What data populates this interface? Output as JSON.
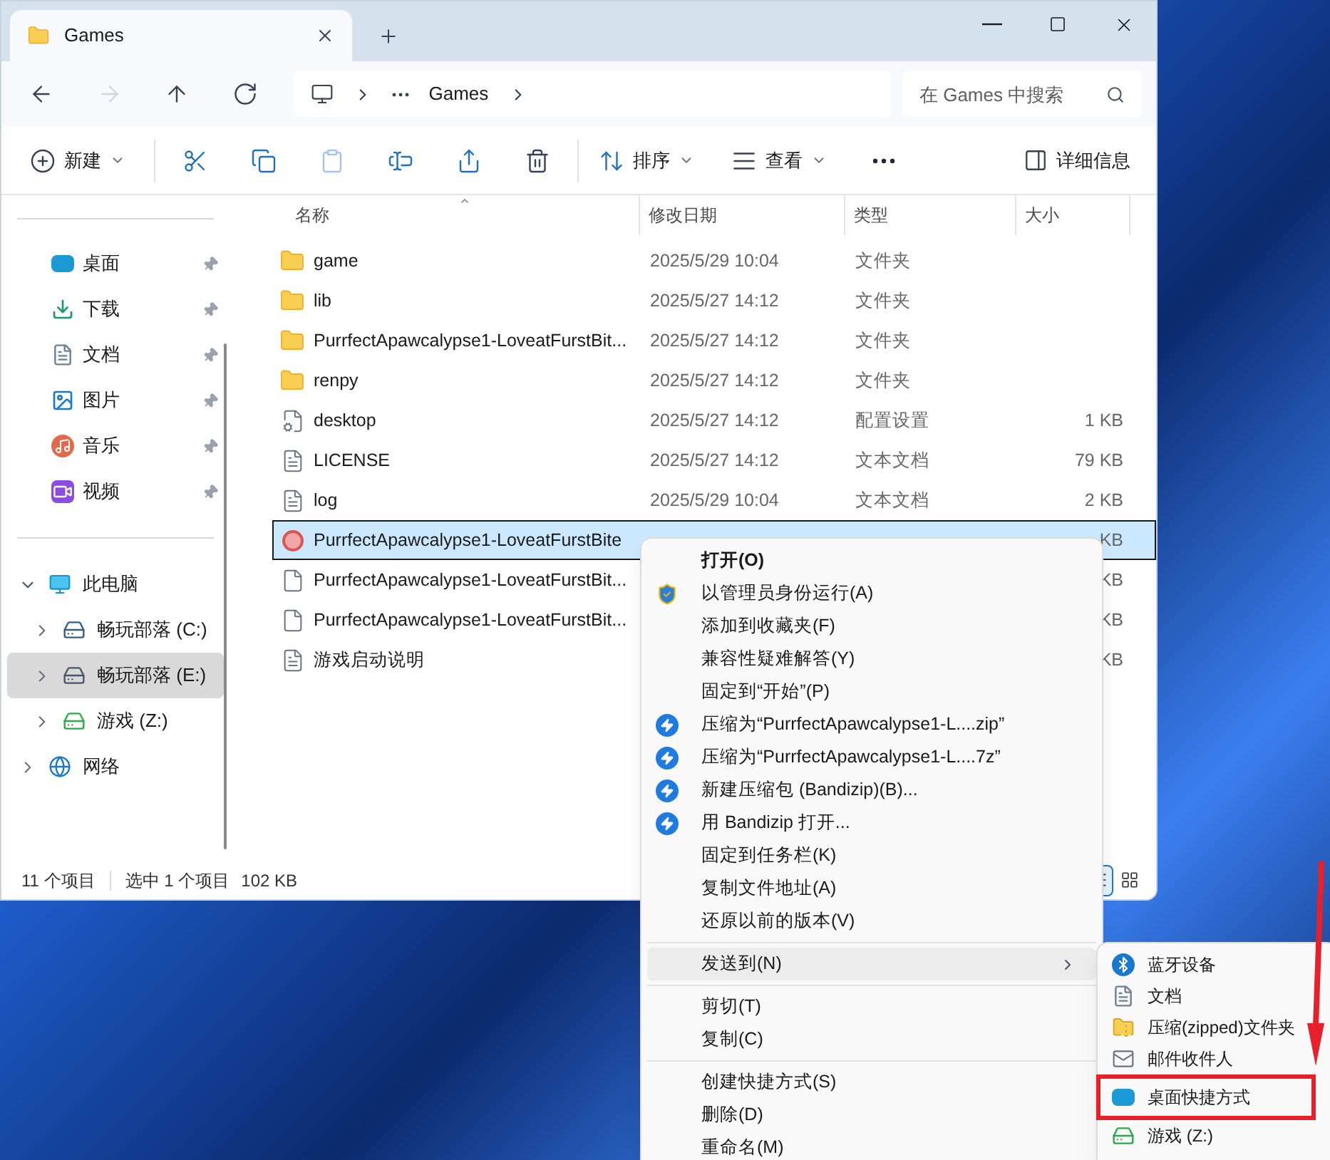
{
  "window": {
    "tab_title": "Games"
  },
  "nav_buttons": [
    {
      "kind": "back",
      "disabled": false
    },
    {
      "kind": "forward",
      "disabled": true
    },
    {
      "kind": "up",
      "disabled": false
    },
    {
      "kind": "refresh",
      "disabled": false
    }
  ],
  "address": {
    "segments": [
      "Games"
    ]
  },
  "search": {
    "placeholder": "在 Games 中搜索"
  },
  "toolbar": [
    {
      "kind": "new",
      "label": "新建",
      "dropdown": true,
      "disabled": false
    },
    {
      "kind": "cut",
      "dropdown": false,
      "disabled": false
    },
    {
      "kind": "copy",
      "dropdown": false,
      "disabled": false
    },
    {
      "kind": "paste",
      "dropdown": false,
      "disabled": true
    },
    {
      "kind": "rename",
      "dropdown": false,
      "disabled": false
    },
    {
      "kind": "share",
      "dropdown": false,
      "disabled": false
    },
    {
      "kind": "delete",
      "dropdown": false,
      "disabled": false
    },
    {
      "kind": "sort",
      "label": "排序",
      "dropdown": true,
      "disabled": false
    },
    {
      "kind": "view",
      "label": "查看",
      "dropdown": true,
      "disabled": false
    },
    {
      "kind": "more",
      "dropdown": false,
      "disabled": false
    }
  ],
  "details_button": {
    "label": "详细信息"
  },
  "sidebar": {
    "quick_access": [
      {
        "kind": "desktop",
        "label": "桌面",
        "pinned": true
      },
      {
        "kind": "downloads",
        "label": "下载",
        "pinned": true
      },
      {
        "kind": "documents",
        "label": "文档",
        "pinned": true
      },
      {
        "kind": "pictures",
        "label": "图片",
        "pinned": true
      },
      {
        "kind": "music",
        "label": "音乐",
        "pinned": true
      },
      {
        "kind": "videos",
        "label": "视频",
        "pinned": true
      }
    ],
    "tree": [
      {
        "kind": "pc",
        "label": "此电脑",
        "expanded": true,
        "selected": false,
        "children": [
          {
            "kind": "system-drive",
            "label": "畅玩部落 (C:)",
            "expanded": false,
            "selected": false
          },
          {
            "kind": "drive",
            "label": "畅玩部落 (E:)",
            "expanded": false,
            "selected": true
          },
          {
            "kind": "game-drive",
            "label": "游戏 (Z:)",
            "expanded": false,
            "selected": false
          }
        ]
      },
      {
        "kind": "network",
        "label": "网络",
        "expanded": false,
        "selected": false
      }
    ]
  },
  "table": {
    "columns": [
      {
        "label": "名称",
        "sorted": true
      },
      {
        "label": "修改日期",
        "sorted": false
      },
      {
        "label": "类型",
        "sorted": false
      },
      {
        "label": "大小",
        "sorted": false
      }
    ],
    "rows": [
      {
        "kind": "folder",
        "name": "game",
        "date": "2025/5/29 10:04",
        "type": "文件夹",
        "selected": false
      },
      {
        "kind": "folder",
        "name": "lib",
        "date": "2025/5/27 14:12",
        "type": "文件夹",
        "selected": false
      },
      {
        "kind": "folder",
        "name": "PurrfectApawcalypse1-LoveatFurstBit...",
        "date": "2025/5/27 14:12",
        "type": "文件夹",
        "selected": false
      },
      {
        "kind": "folder",
        "name": "renpy",
        "date": "2025/5/27 14:12",
        "type": "文件夹",
        "selected": false
      },
      {
        "kind": "settings",
        "name": "desktop",
        "date": "2025/5/27 14:12",
        "type": "配置设置",
        "size": "1 KB",
        "selected": false
      },
      {
        "kind": "text",
        "name": "LICENSE",
        "date": "2025/5/27 14:12",
        "type": "文本文档",
        "size": "79 KB",
        "selected": false
      },
      {
        "kind": "text",
        "name": "log",
        "date": "2025/5/29 10:04",
        "type": "文本文档",
        "size": "2 KB",
        "selected": false
      },
      {
        "kind": "app",
        "name": "PurrfectApawcalypse1-LoveatFurstBite",
        "size": "KB",
        "selected": true
      },
      {
        "kind": "blank",
        "name": "PurrfectApawcalypse1-LoveatFurstBit...",
        "size": "KB",
        "selected": false
      },
      {
        "kind": "blank",
        "name": "PurrfectApawcalypse1-LoveatFurstBit...",
        "size": "KB",
        "selected": false
      },
      {
        "kind": "text",
        "name": "游戏启动说明",
        "size": "KB",
        "selected": false
      }
    ]
  },
  "status_bar": {
    "item_count": "11 个项目",
    "selection": "选中 1 个项目",
    "selection_size": "102 KB",
    "view_buttons": [
      {
        "kind": "details",
        "selected": true
      },
      {
        "kind": "tiles",
        "selected": false
      }
    ]
  },
  "context_menu": {
    "groups": [
      [
        {
          "kind": "plain",
          "label": "打开(O)",
          "default": true,
          "highlighted": false
        },
        {
          "kind": "admin",
          "label": "以管理员身份运行(A)",
          "default": false,
          "highlighted": false
        },
        {
          "kind": "plain",
          "label": "添加到收藏夹(F)",
          "default": false,
          "highlighted": false
        },
        {
          "kind": "plain",
          "label": "兼容性疑难解答(Y)",
          "default": false,
          "highlighted": false
        },
        {
          "kind": "plain",
          "label": "固定到“开始”(P)",
          "default": false,
          "highlighted": false
        },
        {
          "kind": "bandizip",
          "label": "压缩为“PurrfectApawcalypse1-L....zip”",
          "default": false,
          "highlighted": false
        },
        {
          "kind": "bandizip",
          "label": "压缩为“PurrfectApawcalypse1-L....7z”",
          "default": false,
          "highlighted": false
        },
        {
          "kind": "bandizip",
          "label": "新建压缩包 (Bandizip)(B)...",
          "default": false,
          "highlighted": false
        },
        {
          "kind": "bandizip",
          "label": "用 Bandizip 打开...",
          "default": false,
          "highlighted": false
        },
        {
          "kind": "plain",
          "label": "固定到任务栏(K)",
          "default": false,
          "highlighted": false
        },
        {
          "kind": "plain",
          "label": "复制文件地址(A)",
          "default": false,
          "highlighted": false
        },
        {
          "kind": "plain",
          "label": "还原以前的版本(V)",
          "default": false,
          "highlighted": false
        }
      ],
      [
        {
          "kind": "submenu",
          "label": "发送到(N)",
          "default": false,
          "highlighted": true
        }
      ],
      [
        {
          "kind": "plain",
          "label": "剪切(T)",
          "default": false,
          "highlighted": false
        },
        {
          "kind": "plain",
          "label": "复制(C)",
          "default": false,
          "highlighted": false
        }
      ],
      [
        {
          "kind": "plain",
          "label": "创建快捷方式(S)",
          "default": false,
          "highlighted": false
        },
        {
          "kind": "plain",
          "label": "删除(D)",
          "default": false,
          "highlighted": false
        },
        {
          "kind": "plain",
          "label": "重命名(M)",
          "default": false,
          "highlighted": false
        }
      ]
    ]
  },
  "submenu": {
    "items": [
      {
        "kind": "bluetooth",
        "label": "蓝牙设备",
        "annotated": false
      },
      {
        "kind": "documents",
        "label": "文档",
        "annotated": false
      },
      {
        "kind": "zip-folder",
        "label": "压缩(zipped)文件夹",
        "annotated": false
      },
      {
        "kind": "mail",
        "label": "邮件收件人",
        "annotated": false
      },
      {
        "kind": "desktop",
        "label": "桌面快捷方式",
        "annotated": true
      },
      {
        "kind": "game-drive",
        "label": "游戏 (Z:)",
        "annotated": false
      }
    ]
  }
}
